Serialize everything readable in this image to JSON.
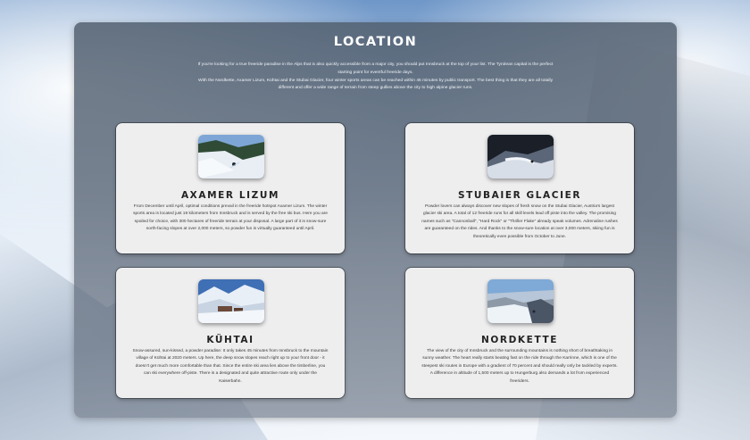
{
  "section": {
    "title": "LOCATION",
    "intro_line_1": "If you're looking for a true freeride paradise in the Alps that is also quickly accessible from a major city, you should put Innsbruck at the top of your list. The Tyrolean capital is the perfect starting point for eventful freeride days.",
    "intro_line_2": "With the Nordkette, Axamer Lizum, Kühtai and the Stubai Glacier, four winter sports areas can be reached within 45 minutes by public transport. The best thing is that they are all totally different and offer a wide range of terrain from steep gullies above the city to high alpine glacier runs."
  },
  "cards": [
    {
      "name": "AXAMER LIZUM",
      "description": "From December until April, optimal conditions prevail in the freeride hotspot Axamer Lizum. The winter sports area is located just 19 kilometers from Innsbruck and is served by the free ski bus. Here you are spoiled for choice, with 300 hectares of freeride terrain at your disposal. A large part of it is snow-sure north-facing slopes at over 2,000 meters, so powder fun is virtually guaranteed until April.",
      "photo_icon": "axamer-lizum-photo"
    },
    {
      "name": "STUBAIER GLACIER",
      "description": "Powder lovers can always discover new slopes of fresh snow on the Stubai Glacier, Austria's largest glacier ski area. A total of 12 freeride runs for all skill levels lead off piste into the valley. The promising names such as \"Cannonball\", \"Hard Rock\" or \"Thriller Flake\" already speak volumes. Adrenaline rushes are guaranteed on the rides. And thanks to the snow-sure location at over 3,000 meters, skiing fun is theoretically even possible from October to June.",
      "photo_icon": "stubaier-glacier-photo"
    },
    {
      "name": "KÜHTAI",
      "description": "Snow-assured, sun-kissed, a powder paradise: It only takes 45 minutes from Innsbruck to the mountain village of Kühtai at 2020 meters. Up here, the deep snow slopes reach right up to your front door - it doesn't get much more comfortable than that. Since the entire ski area lies above the timberline, you can ski everywhere off-piste. There is a designated and quite attractive route only under the Kaiserbahn.",
      "photo_icon": "kuehtai-photo"
    },
    {
      "name": "NORDKETTE",
      "description": "The view of the city of Innsbruck and the surrounding mountains is nothing short of breathtaking in sunny weather. The heart really starts beating fast on the ride through the Karrinne, which is one of the steepest ski routes in Europe with a gradient of 70 percent and should really only be tackled by experts. A difference in altitude of 1,500 meters up to Hungerburg also demands a lot from experienced freeriders.",
      "photo_icon": "nordkette-photo"
    }
  ]
}
